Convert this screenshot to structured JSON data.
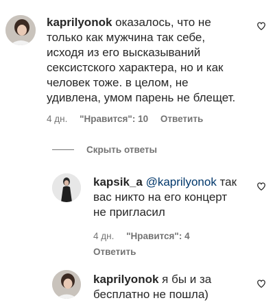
{
  "comments": [
    {
      "username": "kaprilyonok",
      "text": "оказалось, что не только как мужчина так себе, исходя из его высказываний сексистского характера, но и как человек тоже. в целом, не удивлена, умом парень не блещет.",
      "lines": [
        "оказалось, что не",
        "только как мужчина так себе,",
        "исходя из его высказываний",
        "сексистского характера, но и как",
        "человек тоже. в целом, не",
        "удивлена, умом парень не блещет."
      ],
      "time": "4 дн.",
      "likes": "\"Нравится\": 10",
      "reply": "Ответить"
    },
    {
      "username": "kapsik_a",
      "mention": "@kaprilyonok",
      "lines_after_mention": [
        "так",
        "вас никто на его концерт",
        "не пригласил"
      ],
      "time": "4 дн.",
      "likes": "\"Нравится\": 4",
      "reply": "Ответить"
    },
    {
      "username": "kaprilyonok",
      "lines": [
        "я бы и за",
        "бесплатно не пошла)"
      ]
    }
  ],
  "hide_replies": "Скрыть ответы",
  "icons": {
    "like": "heart-outline-icon"
  }
}
